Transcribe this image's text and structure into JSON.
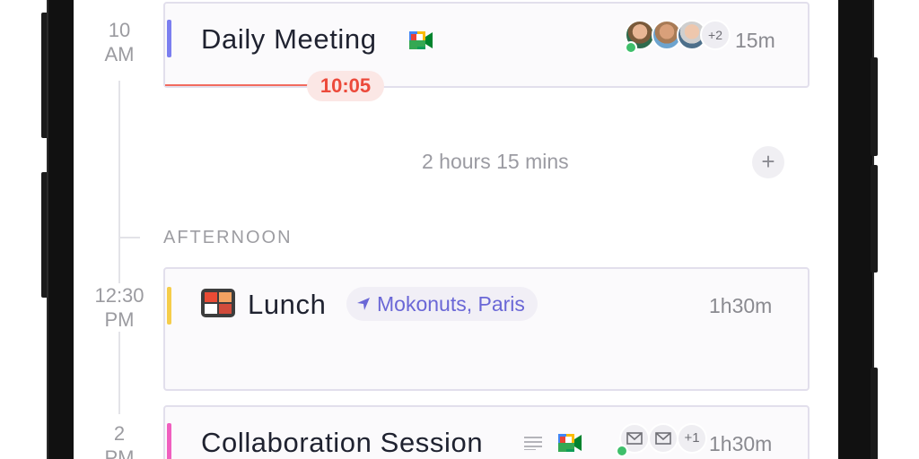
{
  "now": {
    "time": "10:05"
  },
  "times": {
    "t10": {
      "hour": "10",
      "period": "AM"
    },
    "t1230": {
      "hour": "12:30",
      "period": "PM"
    },
    "t2": {
      "hour": "2",
      "period": "PM"
    }
  },
  "events": {
    "daily": {
      "title": "Daily Meeting",
      "duration": "15m",
      "extra_attendees": "+2",
      "accent_color": "#7b7ef0"
    },
    "lunch": {
      "title": "Lunch",
      "location": "Mokonuts, Paris",
      "duration": "1h30m",
      "accent_color": "#f5cd4b"
    },
    "collab": {
      "title": "Collaboration Session",
      "duration": "1h30m",
      "extra_attendees": "+1",
      "accent_color": "#f05fbf"
    }
  },
  "gap": {
    "label": "2 hours 15 mins",
    "add_icon": "plus-icon"
  },
  "sections": {
    "afternoon": "AFTERNOON"
  },
  "colors": {
    "now_indicator": "#ec4a3b",
    "location_text": "#6a67d6",
    "card_border": "#e2dfec"
  }
}
